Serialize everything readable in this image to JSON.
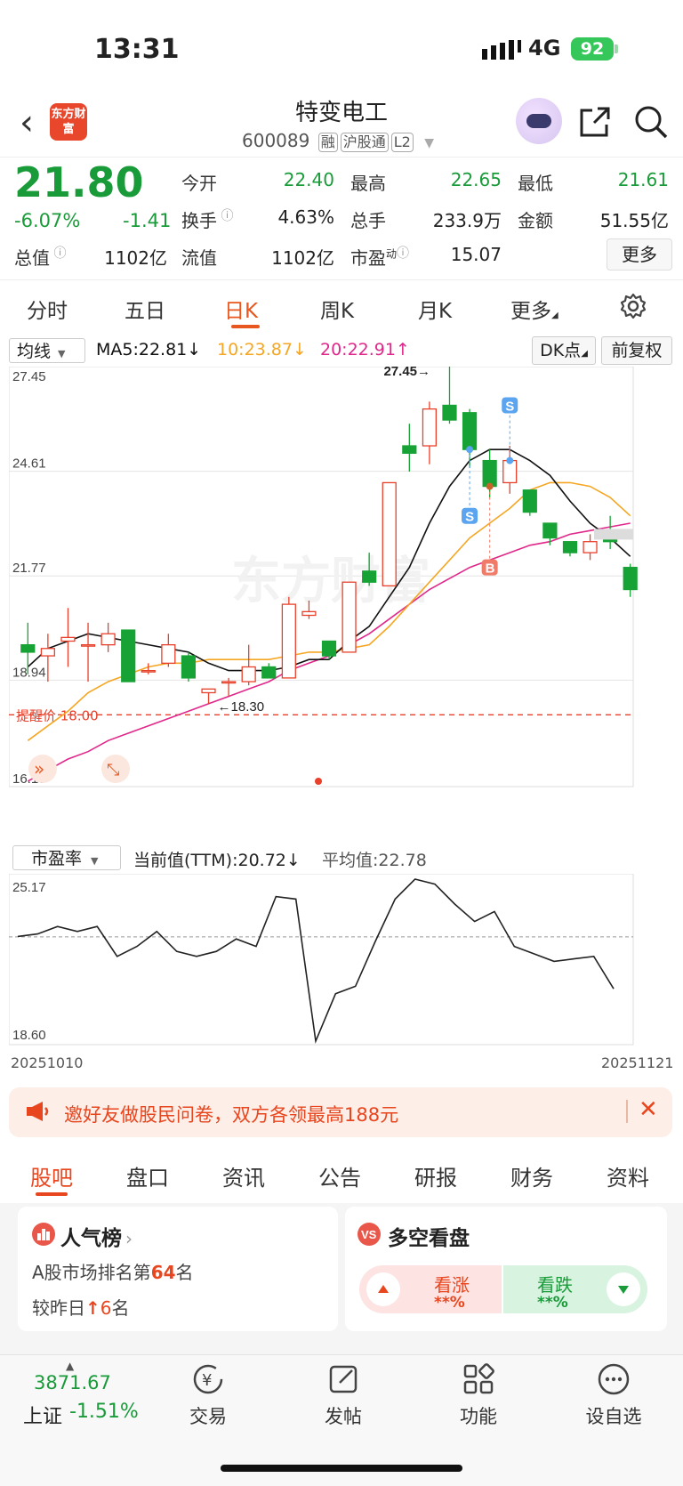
{
  "status": {
    "time": "13:31",
    "network": "4G",
    "battery": "92"
  },
  "header": {
    "logo": "东方财富",
    "stock_name": "特变电工",
    "stock_code": "600089",
    "tags": [
      "融",
      "沪股通",
      "L2"
    ]
  },
  "quote": {
    "price": "21.80",
    "change_pct": "-6.07%",
    "change": "-1.41",
    "open_label": "今开",
    "open": "22.40",
    "high_label": "最高",
    "high": "22.65",
    "low_label": "最低",
    "low": "21.61",
    "turnover_label": "换手",
    "turnover": "4.63%",
    "volume_label": "总手",
    "volume": "233.9万",
    "amount_label": "金额",
    "amount": "51.55亿",
    "mktcap_label": "总值",
    "mktcap": "1102亿",
    "float_label": "流值",
    "float": "1102亿",
    "pe_label": "市盈",
    "pe_sup": "动",
    "pe": "15.07",
    "more": "更多"
  },
  "period_tabs": [
    "分时",
    "五日",
    "日K",
    "周K",
    "月K",
    "更多"
  ],
  "active_period": "日K",
  "ma_bar": {
    "select": "均线",
    "ma5": "MA5:22.81↓",
    "ma10": "10:23.87↓",
    "ma20": "20:22.91↑",
    "dk": "DK点",
    "adjust": "前复权",
    "colors": {
      "ma5": "#111111",
      "ma10": "#f5a623",
      "ma20": "#e0278a",
      "up": "#e8402a",
      "down": "#16a234"
    }
  },
  "chart_data": [
    {
      "type": "candlestick",
      "ylim": [
        16.1,
        27.45
      ],
      "y_ticks": [
        "27.45",
        "24.61",
        "21.77",
        "18.94",
        "16.10"
      ],
      "max_label": "27.45",
      "min_label": "18.30",
      "alert_label": "提醒价 18.00",
      "alert_price": 18.0,
      "candles": [
        {
          "o": 19.9,
          "c": 19.7,
          "h": 20.5,
          "l": 19.1
        },
        {
          "o": 19.6,
          "c": 19.8,
          "h": 20.2,
          "l": 18.9
        },
        {
          "o": 20.0,
          "c": 20.1,
          "h": 20.9,
          "l": 19.3
        },
        {
          "o": 19.9,
          "c": 19.9,
          "h": 20.5,
          "l": 18.9
        },
        {
          "o": 19.9,
          "c": 20.2,
          "h": 20.5,
          "l": 19.7
        },
        {
          "o": 20.3,
          "c": 18.9,
          "h": 20.3,
          "l": 18.9
        },
        {
          "o": 19.2,
          "c": 19.2,
          "h": 19.4,
          "l": 19.1
        },
        {
          "o": 19.4,
          "c": 19.9,
          "h": 20.2,
          "l": 19.3
        },
        {
          "o": 19.6,
          "c": 19.0,
          "h": 19.7,
          "l": 18.9
        },
        {
          "o": 18.6,
          "c": 18.7,
          "h": 18.7,
          "l": 18.3
        },
        {
          "o": 18.9,
          "c": 18.9,
          "h": 19.0,
          "l": 18.5
        },
        {
          "o": 18.9,
          "c": 19.3,
          "h": 19.9,
          "l": 18.8
        },
        {
          "o": 19.3,
          "c": 19.0,
          "h": 19.4,
          "l": 19.0
        },
        {
          "o": 19.0,
          "c": 21.0,
          "h": 21.2,
          "l": 19.0
        },
        {
          "o": 20.7,
          "c": 20.8,
          "h": 21.1,
          "l": 20.6
        },
        {
          "o": 20.0,
          "c": 19.6,
          "h": 20.0,
          "l": 19.5
        },
        {
          "o": 19.7,
          "c": 21.6,
          "h": 21.6,
          "l": 19.7
        },
        {
          "o": 21.9,
          "c": 21.6,
          "h": 22.4,
          "l": 21.5
        },
        {
          "o": 21.5,
          "c": 24.3,
          "h": 24.3,
          "l": 21.5
        },
        {
          "o": 25.3,
          "c": 25.1,
          "h": 25.9,
          "l": 24.6
        },
        {
          "o": 25.3,
          "c": 26.3,
          "h": 26.5,
          "l": 24.8
        },
        {
          "o": 26.4,
          "c": 26.0,
          "h": 27.45,
          "l": 25.9
        },
        {
          "o": 26.2,
          "c": 25.2,
          "h": 26.3,
          "l": 24.7
        },
        {
          "o": 24.9,
          "c": 24.2,
          "h": 25.2,
          "l": 23.9
        },
        {
          "o": 24.3,
          "c": 24.9,
          "h": 25.3,
          "l": 24.0
        },
        {
          "o": 24.1,
          "c": 23.5,
          "h": 24.1,
          "l": 23.4
        },
        {
          "o": 23.2,
          "c": 22.8,
          "h": 23.2,
          "l": 22.6
        },
        {
          "o": 22.7,
          "c": 22.4,
          "h": 22.7,
          "l": 22.3
        },
        {
          "o": 22.4,
          "c": 22.7,
          "h": 22.9,
          "l": 22.2
        },
        {
          "o": 22.8,
          "c": 22.7,
          "h": 23.4,
          "l": 22.5
        },
        {
          "o": 22.0,
          "c": 21.4,
          "h": 22.1,
          "l": 21.2
        }
      ],
      "ma5": [
        19.3,
        19.8,
        20.0,
        20.2,
        20.1,
        20.0,
        19.9,
        19.8,
        19.7,
        19.4,
        19.2,
        19.2,
        19.2,
        19.3,
        19.5,
        19.5,
        20.0,
        20.4,
        21.2,
        22.0,
        23.2,
        24.2,
        24.9,
        25.2,
        25.2,
        24.9,
        24.5,
        23.8,
        23.2,
        22.8,
        22.3
      ],
      "ma10": [
        17.3,
        17.7,
        18.1,
        18.6,
        18.9,
        19.1,
        19.3,
        19.4,
        19.4,
        19.5,
        19.5,
        19.5,
        19.5,
        19.6,
        19.7,
        19.7,
        19.8,
        19.9,
        20.4,
        21.0,
        21.6,
        22.2,
        22.8,
        23.2,
        23.6,
        24.1,
        24.3,
        24.3,
        24.2,
        23.9,
        23.4
      ],
      "ma20": [
        16.2,
        16.5,
        16.8,
        17.0,
        17.3,
        17.5,
        17.7,
        17.9,
        18.1,
        18.3,
        18.5,
        18.7,
        18.9,
        19.2,
        19.4,
        19.6,
        19.9,
        20.2,
        20.6,
        21.0,
        21.4,
        21.7,
        22.0,
        22.2,
        22.4,
        22.6,
        22.7,
        22.9,
        23.0,
        23.1,
        23.2
      ],
      "signals": [
        {
          "label": "S"
        },
        {
          "label": "S"
        },
        {
          "label": "B"
        }
      ]
    },
    {
      "type": "line",
      "title": "市盈率",
      "ylim": [
        18.6,
        25.17
      ],
      "y_ticks": [
        "25.17",
        "18.60"
      ],
      "x_start": "20251010",
      "x_end": "20251121",
      "current": "当前值(TTM):20.72↓",
      "average": "平均值:22.78",
      "avg_value": 22.78,
      "values": [
        22.8,
        22.9,
        23.2,
        23.0,
        23.2,
        22.0,
        22.4,
        23.0,
        22.2,
        22.0,
        22.2,
        22.7,
        22.4,
        24.4,
        24.3,
        18.6,
        20.5,
        20.8,
        22.6,
        24.3,
        25.1,
        24.9,
        24.1,
        23.4,
        23.8,
        22.4,
        22.1,
        21.8,
        21.9,
        22.0,
        20.7
      ]
    }
  ],
  "pe_select": "市盈率",
  "banner": {
    "text": "邀好友做股民问卷，双方各领最高188元"
  },
  "bottom_tabs": [
    "股吧",
    "盘口",
    "资讯",
    "公告",
    "研报",
    "财务",
    "资料"
  ],
  "popularity": {
    "title": "人气榜",
    "line1_prefix": "A股市场排名第",
    "rank": "64",
    "line1_suffix": "名",
    "line2_prefix": "较昨日",
    "change": "6",
    "line2_suffix": "名"
  },
  "vs": {
    "title": "多空看盘",
    "bull_label": "看涨",
    "bull_value": "**%",
    "bear_label": "看跌",
    "bear_value": "**%"
  },
  "index": {
    "value": "3871.67",
    "name": "上证",
    "pct": "-1.51%"
  },
  "nav": [
    "交易",
    "发帖",
    "功能",
    "设自选"
  ]
}
